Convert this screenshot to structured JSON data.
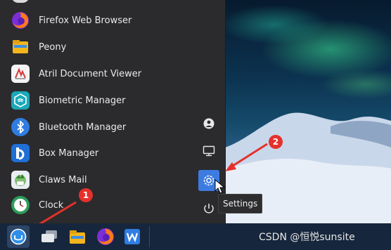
{
  "apps": [
    {
      "label": "Firefox Web Browser",
      "icon": "firefox-icon"
    },
    {
      "label": "Peony",
      "icon": "folder-icon"
    },
    {
      "label": "Atril Document Viewer",
      "icon": "document-viewer-icon"
    },
    {
      "label": "Biometric Manager",
      "icon": "biometric-icon"
    },
    {
      "label": "Bluetooth Manager",
      "icon": "bluetooth-icon"
    },
    {
      "label": "Box Manager",
      "icon": "box-manager-icon"
    },
    {
      "label": "Claws Mail",
      "icon": "mail-icon"
    },
    {
      "label": "Clock",
      "icon": "clock-icon"
    }
  ],
  "sidebar": {
    "tooltip": "Settings"
  },
  "annotations": {
    "marker1": "1",
    "marker2": "2"
  },
  "watermark": "CSDN @恒悦sunsite",
  "colors": {
    "menu_bg": "#2b2b2d",
    "accent": "#3d7be0",
    "taskbar": "#16263c",
    "annotation": "#e5312b"
  }
}
